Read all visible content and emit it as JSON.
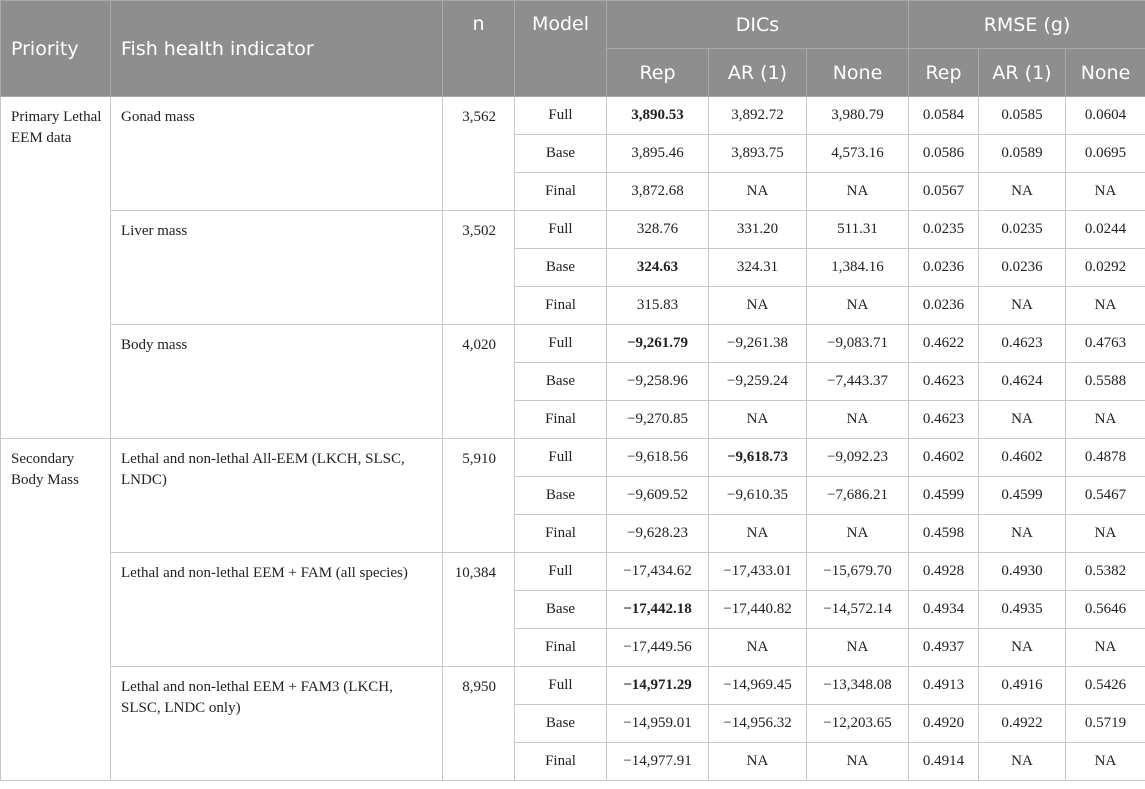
{
  "header": {
    "priority": "Priority",
    "indicator": "Fish health indicator",
    "n": "n",
    "model": "Model",
    "dics": "DICs",
    "rmse": "RMSE (g)",
    "rep": "Rep",
    "ar1": "AR (1)",
    "none": "None"
  },
  "groups": [
    {
      "priority": "Primary Lethal EEM data",
      "indicators": [
        {
          "name": "Gonad mass",
          "n": "3,562",
          "rows": [
            {
              "model": "Full",
              "dic_rep": "3,890.53",
              "dic_rep_bold": true,
              "dic_ar1": "3,892.72",
              "dic_none": "3,980.79",
              "rmse_rep": "0.0584",
              "rmse_ar1": "0.0585",
              "rmse_none": "0.0604"
            },
            {
              "model": "Base",
              "dic_rep": "3,895.46",
              "dic_ar1": "3,893.75",
              "dic_none": "4,573.16",
              "rmse_rep": "0.0586",
              "rmse_ar1": "0.0589",
              "rmse_none": "0.0695"
            },
            {
              "model": "Final",
              "dic_rep": "3,872.68",
              "dic_ar1": "NA",
              "dic_none": "NA",
              "rmse_rep": "0.0567",
              "rmse_ar1": "NA",
              "rmse_none": "NA"
            }
          ]
        },
        {
          "name": "Liver mass",
          "n": "3,502",
          "rows": [
            {
              "model": "Full",
              "dic_rep": "328.76",
              "dic_ar1": "331.20",
              "dic_none": "511.31",
              "rmse_rep": "0.0235",
              "rmse_ar1": "0.0235",
              "rmse_none": "0.0244"
            },
            {
              "model": "Base",
              "dic_rep": "324.63",
              "dic_rep_bold": true,
              "dic_ar1": "324.31",
              "dic_none": "1,384.16",
              "rmse_rep": "0.0236",
              "rmse_ar1": "0.0236",
              "rmse_none": "0.0292"
            },
            {
              "model": "Final",
              "dic_rep": "315.83",
              "dic_ar1": "NA",
              "dic_none": "NA",
              "rmse_rep": "0.0236",
              "rmse_ar1": "NA",
              "rmse_none": "NA"
            }
          ]
        },
        {
          "name": "Body mass",
          "n": "4,020",
          "rows": [
            {
              "model": "Full",
              "dic_rep": "−9,261.79",
              "dic_rep_bold": true,
              "dic_ar1": "−9,261.38",
              "dic_none": "−9,083.71",
              "rmse_rep": "0.4622",
              "rmse_ar1": "0.4623",
              "rmse_none": "0.4763"
            },
            {
              "model": "Base",
              "dic_rep": "−9,258.96",
              "dic_ar1": "−9,259.24",
              "dic_none": "−7,443.37",
              "rmse_rep": "0.4623",
              "rmse_ar1": "0.4624",
              "rmse_none": "0.5588"
            },
            {
              "model": "Final",
              "dic_rep": "−9,270.85",
              "dic_ar1": "NA",
              "dic_none": "NA",
              "rmse_rep": "0.4623",
              "rmse_ar1": "NA",
              "rmse_none": "NA"
            }
          ]
        }
      ]
    },
    {
      "priority": "Secondary Body Mass",
      "indicators": [
        {
          "name": "Lethal and non-lethal All-EEM (LKCH, SLSC, LNDC)",
          "n": "5,910",
          "rows": [
            {
              "model": "Full",
              "dic_rep": "−9,618.56",
              "dic_ar1": "−9,618.73",
              "dic_ar1_bold": true,
              "dic_none": "−9,092.23",
              "rmse_rep": "0.4602",
              "rmse_ar1": "0.4602",
              "rmse_none": "0.4878"
            },
            {
              "model": "Base",
              "dic_rep": "−9,609.52",
              "dic_ar1": "−9,610.35",
              "dic_none": "−7,686.21",
              "rmse_rep": "0.4599",
              "rmse_ar1": "0.4599",
              "rmse_none": "0.5467"
            },
            {
              "model": "Final",
              "dic_rep": "−9,628.23",
              "dic_ar1": "NA",
              "dic_none": "NA",
              "rmse_rep": "0.4598",
              "rmse_ar1": "NA",
              "rmse_none": "NA"
            }
          ]
        },
        {
          "name": "Lethal and non-lethal EEM + FAM (all species)",
          "n": "10,384",
          "rows": [
            {
              "model": "Full",
              "dic_rep": "−17,434.62",
              "dic_ar1": "−17,433.01",
              "dic_none": "−15,679.70",
              "rmse_rep": "0.4928",
              "rmse_ar1": "0.4930",
              "rmse_none": "0.5382"
            },
            {
              "model": "Base",
              "dic_rep": "−17,442.18",
              "dic_rep_bold": true,
              "dic_ar1": "−17,440.82",
              "dic_none": "−14,572.14",
              "rmse_rep": "0.4934",
              "rmse_ar1": "0.4935",
              "rmse_none": "0.5646"
            },
            {
              "model": "Final",
              "dic_rep": "−17,449.56",
              "dic_ar1": "NA",
              "dic_none": "NA",
              "rmse_rep": "0.4937",
              "rmse_ar1": "NA",
              "rmse_none": "NA"
            }
          ]
        },
        {
          "name": "Lethal and non-lethal EEM + FAM3 (LKCH, SLSC, LNDC only)",
          "n": "8,950",
          "rows": [
            {
              "model": "Full",
              "dic_rep": "−14,971.29",
              "dic_rep_bold": true,
              "dic_ar1": "−14,969.45",
              "dic_none": "−13,348.08",
              "rmse_rep": "0.4913",
              "rmse_ar1": "0.4916",
              "rmse_none": "0.5426"
            },
            {
              "model": "Base",
              "dic_rep": "−14,959.01",
              "dic_ar1": "−14,956.32",
              "dic_none": "−12,203.65",
              "rmse_rep": "0.4920",
              "rmse_ar1": "0.4922",
              "rmse_none": "0.5719"
            },
            {
              "model": "Final",
              "dic_rep": "−14,977.91",
              "dic_ar1": "NA",
              "dic_none": "NA",
              "rmse_rep": "0.4914",
              "rmse_ar1": "NA",
              "rmse_none": "NA"
            }
          ]
        }
      ]
    }
  ]
}
